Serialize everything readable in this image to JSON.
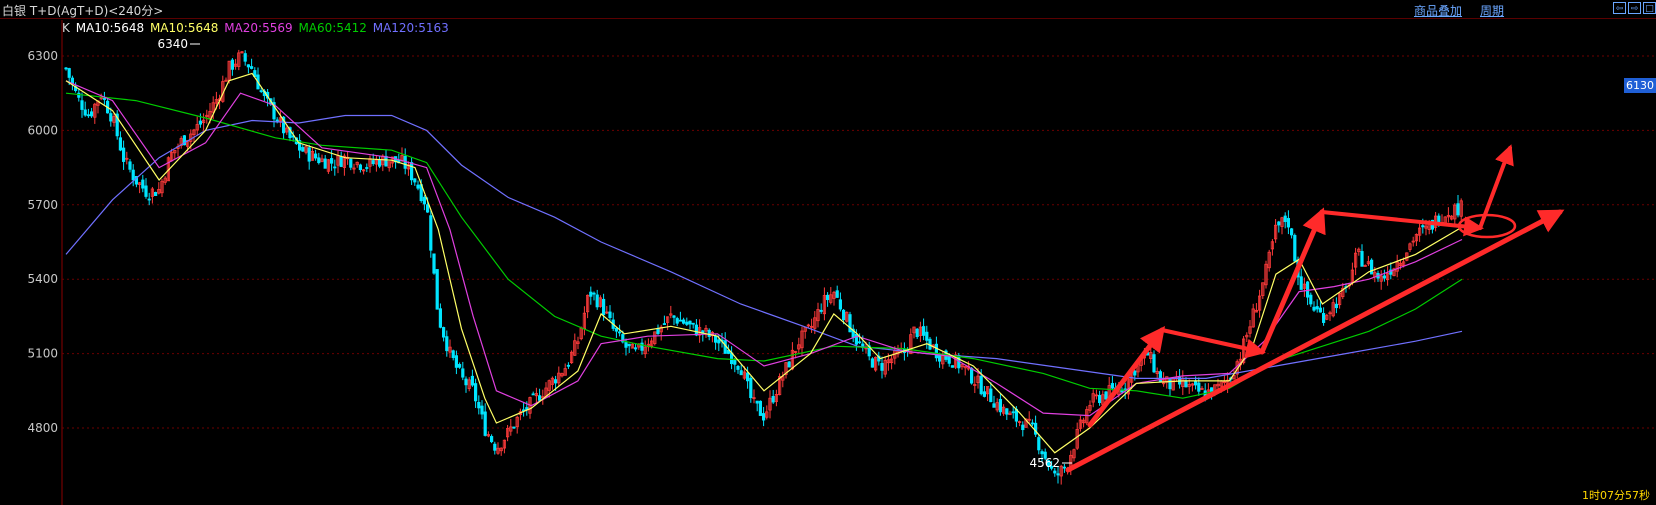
{
  "header": {
    "title": "白银 T+D(AgT+D)<240分>",
    "overlay_link": "商品叠加",
    "period_link": "周期",
    "window_buttons": [
      "⇦",
      "⇨",
      "□"
    ]
  },
  "legend": {
    "k": "K",
    "ma10_a": "MA10:5648",
    "ma10_b": "MA10:5648",
    "ma20": "MA20:5569",
    "ma60": "MA60:5412",
    "ma120": "MA120:5163"
  },
  "price_tag": "6130",
  "timer": "1时07分57秒",
  "colors": {
    "up": "#ff3b3b",
    "down": "#00e5ff",
    "ma10": "#ffff66",
    "ma20": "#e040e0",
    "ma60": "#00cc00",
    "ma120": "#7070ff",
    "grid": "#6b0000",
    "annotation": "#ff2a2a"
  },
  "chart_data": {
    "type": "candlestick",
    "yticks": [
      6300,
      6000,
      5700,
      5400,
      5100,
      4800
    ],
    "ylim": [
      4520,
      6380
    ],
    "high_label": "6340",
    "low_label": "4562",
    "close_path": [
      [
        0,
        6250
      ],
      [
        5,
        6130
      ],
      [
        10,
        6060
      ],
      [
        15,
        6150
      ],
      [
        20,
        6050
      ],
      [
        25,
        5880
      ],
      [
        30,
        5800
      ],
      [
        35,
        5750
      ],
      [
        40,
        5760
      ],
      [
        45,
        5900
      ],
      [
        50,
        5960
      ],
      [
        55,
        6000
      ],
      [
        60,
        6050
      ],
      [
        65,
        6130
      ],
      [
        70,
        6250
      ],
      [
        75,
        6300
      ],
      [
        80,
        6250
      ],
      [
        85,
        6130
      ],
      [
        90,
        6060
      ],
      [
        95,
        5980
      ],
      [
        100,
        5930
      ],
      [
        105,
        5900
      ],
      [
        110,
        5880
      ],
      [
        115,
        5870
      ],
      [
        120,
        5890
      ],
      [
        125,
        5870
      ],
      [
        130,
        5860
      ],
      [
        135,
        5880
      ],
      [
        140,
        5880
      ],
      [
        145,
        5870
      ],
      [
        150,
        5800
      ],
      [
        155,
        5700
      ],
      [
        160,
        5250
      ],
      [
        165,
        5100
      ],
      [
        170,
        5000
      ],
      [
        175,
        4950
      ],
      [
        180,
        4800
      ],
      [
        185,
        4720
      ],
      [
        190,
        4780
      ],
      [
        195,
        4850
      ],
      [
        200,
        4900
      ],
      [
        205,
        4950
      ],
      [
        210,
        5000
      ],
      [
        215,
        5050
      ],
      [
        220,
        5150
      ],
      [
        225,
        5350
      ],
      [
        230,
        5300
      ],
      [
        235,
        5200
      ],
      [
        240,
        5130
      ],
      [
        245,
        5100
      ],
      [
        250,
        5150
      ],
      [
        255,
        5200
      ],
      [
        260,
        5250
      ],
      [
        265,
        5230
      ],
      [
        270,
        5200
      ],
      [
        275,
        5180
      ],
      [
        280,
        5150
      ],
      [
        285,
        5100
      ],
      [
        290,
        5050
      ],
      [
        295,
        4900
      ],
      [
        300,
        4850
      ],
      [
        305,
        4950
      ],
      [
        310,
        5050
      ],
      [
        315,
        5150
      ],
      [
        320,
        5200
      ],
      [
        325,
        5300
      ],
      [
        330,
        5350
      ],
      [
        335,
        5250
      ],
      [
        340,
        5150
      ],
      [
        345,
        5080
      ],
      [
        350,
        5050
      ],
      [
        355,
        5080
      ],
      [
        360,
        5100
      ],
      [
        365,
        5200
      ],
      [
        370,
        5150
      ],
      [
        375,
        5100
      ],
      [
        380,
        5080
      ],
      [
        385,
        5050
      ],
      [
        390,
        5000
      ],
      [
        395,
        4950
      ],
      [
        400,
        4900
      ],
      [
        405,
        4850
      ],
      [
        410,
        4830
      ],
      [
        415,
        4800
      ],
      [
        420,
        4700
      ],
      [
        425,
        4600
      ],
      [
        430,
        4650
      ],
      [
        435,
        4780
      ],
      [
        440,
        4900
      ],
      [
        445,
        4930
      ],
      [
        450,
        4950
      ],
      [
        455,
        4970
      ],
      [
        460,
        5050
      ],
      [
        465,
        5100
      ],
      [
        470,
        5000
      ],
      [
        475,
        4970
      ],
      [
        480,
        4980
      ],
      [
        485,
        4950
      ],
      [
        490,
        4940
      ],
      [
        495,
        4960
      ],
      [
        500,
        5000
      ],
      [
        505,
        5100
      ],
      [
        510,
        5250
      ],
      [
        515,
        5400
      ],
      [
        520,
        5600
      ],
      [
        525,
        5650
      ],
      [
        530,
        5400
      ],
      [
        535,
        5300
      ],
      [
        540,
        5250
      ],
      [
        545,
        5300
      ],
      [
        550,
        5350
      ],
      [
        555,
        5500
      ],
      [
        560,
        5450
      ],
      [
        565,
        5400
      ],
      [
        570,
        5450
      ],
      [
        575,
        5500
      ],
      [
        580,
        5580
      ],
      [
        585,
        5600
      ],
      [
        590,
        5650
      ],
      [
        595,
        5680
      ],
      [
        600,
        5690
      ]
    ],
    "ma10": [
      [
        0,
        6200
      ],
      [
        20,
        6080
      ],
      [
        40,
        5800
      ],
      [
        60,
        6000
      ],
      [
        70,
        6200
      ],
      [
        80,
        6230
      ],
      [
        100,
        5950
      ],
      [
        120,
        5890
      ],
      [
        140,
        5880
      ],
      [
        150,
        5850
      ],
      [
        160,
        5600
      ],
      [
        170,
        5200
      ],
      [
        180,
        4920
      ],
      [
        185,
        4820
      ],
      [
        200,
        4880
      ],
      [
        220,
        5030
      ],
      [
        230,
        5260
      ],
      [
        240,
        5180
      ],
      [
        260,
        5210
      ],
      [
        280,
        5170
      ],
      [
        300,
        4950
      ],
      [
        320,
        5100
      ],
      [
        330,
        5260
      ],
      [
        340,
        5180
      ],
      [
        350,
        5080
      ],
      [
        370,
        5140
      ],
      [
        390,
        5050
      ],
      [
        410,
        4860
      ],
      [
        425,
        4700
      ],
      [
        440,
        4800
      ],
      [
        460,
        4980
      ],
      [
        480,
        4990
      ],
      [
        500,
        4990
      ],
      [
        510,
        5130
      ],
      [
        520,
        5420
      ],
      [
        530,
        5480
      ],
      [
        540,
        5300
      ],
      [
        560,
        5430
      ],
      [
        580,
        5500
      ],
      [
        600,
        5610
      ]
    ],
    "ma20": [
      [
        0,
        6200
      ],
      [
        20,
        6120
      ],
      [
        40,
        5850
      ],
      [
        60,
        5950
      ],
      [
        75,
        6150
      ],
      [
        90,
        6100
      ],
      [
        110,
        5930
      ],
      [
        140,
        5890
      ],
      [
        155,
        5850
      ],
      [
        165,
        5600
      ],
      [
        175,
        5250
      ],
      [
        185,
        4950
      ],
      [
        200,
        4890
      ],
      [
        220,
        4990
      ],
      [
        230,
        5140
      ],
      [
        250,
        5170
      ],
      [
        280,
        5180
      ],
      [
        300,
        5050
      ],
      [
        320,
        5100
      ],
      [
        340,
        5170
      ],
      [
        360,
        5110
      ],
      [
        380,
        5090
      ],
      [
        400,
        4980
      ],
      [
        420,
        4860
      ],
      [
        440,
        4850
      ],
      [
        460,
        4980
      ],
      [
        480,
        5010
      ],
      [
        500,
        5020
      ],
      [
        515,
        5150
      ],
      [
        530,
        5350
      ],
      [
        545,
        5370
      ],
      [
        560,
        5400
      ],
      [
        580,
        5470
      ],
      [
        600,
        5560
      ]
    ],
    "ma60": [
      [
        0,
        6150
      ],
      [
        30,
        6120
      ],
      [
        60,
        6050
      ],
      [
        90,
        5970
      ],
      [
        110,
        5940
      ],
      [
        140,
        5920
      ],
      [
        155,
        5870
      ],
      [
        170,
        5650
      ],
      [
        190,
        5400
      ],
      [
        210,
        5250
      ],
      [
        230,
        5170
      ],
      [
        250,
        5130
      ],
      [
        280,
        5080
      ],
      [
        300,
        5070
      ],
      [
        330,
        5130
      ],
      [
        360,
        5120
      ],
      [
        390,
        5080
      ],
      [
        420,
        5020
      ],
      [
        440,
        4960
      ],
      [
        460,
        4950
      ],
      [
        480,
        4920
      ],
      [
        500,
        4960
      ],
      [
        520,
        5070
      ],
      [
        540,
        5130
      ],
      [
        560,
        5190
      ],
      [
        580,
        5280
      ],
      [
        600,
        5400
      ]
    ],
    "ma120": [
      [
        0,
        5500
      ],
      [
        20,
        5720
      ],
      [
        40,
        5890
      ],
      [
        60,
        6000
      ],
      [
        80,
        6040
      ],
      [
        100,
        6030
      ],
      [
        120,
        6060
      ],
      [
        140,
        6060
      ],
      [
        155,
        6000
      ],
      [
        170,
        5860
      ],
      [
        190,
        5730
      ],
      [
        210,
        5650
      ],
      [
        230,
        5550
      ],
      [
        260,
        5430
      ],
      [
        290,
        5300
      ],
      [
        320,
        5200
      ],
      [
        340,
        5130
      ],
      [
        370,
        5100
      ],
      [
        400,
        5080
      ],
      [
        430,
        5040
      ],
      [
        460,
        5000
      ],
      [
        490,
        5000
      ],
      [
        520,
        5050
      ],
      [
        550,
        5100
      ],
      [
        580,
        5150
      ],
      [
        600,
        5190
      ]
    ]
  }
}
